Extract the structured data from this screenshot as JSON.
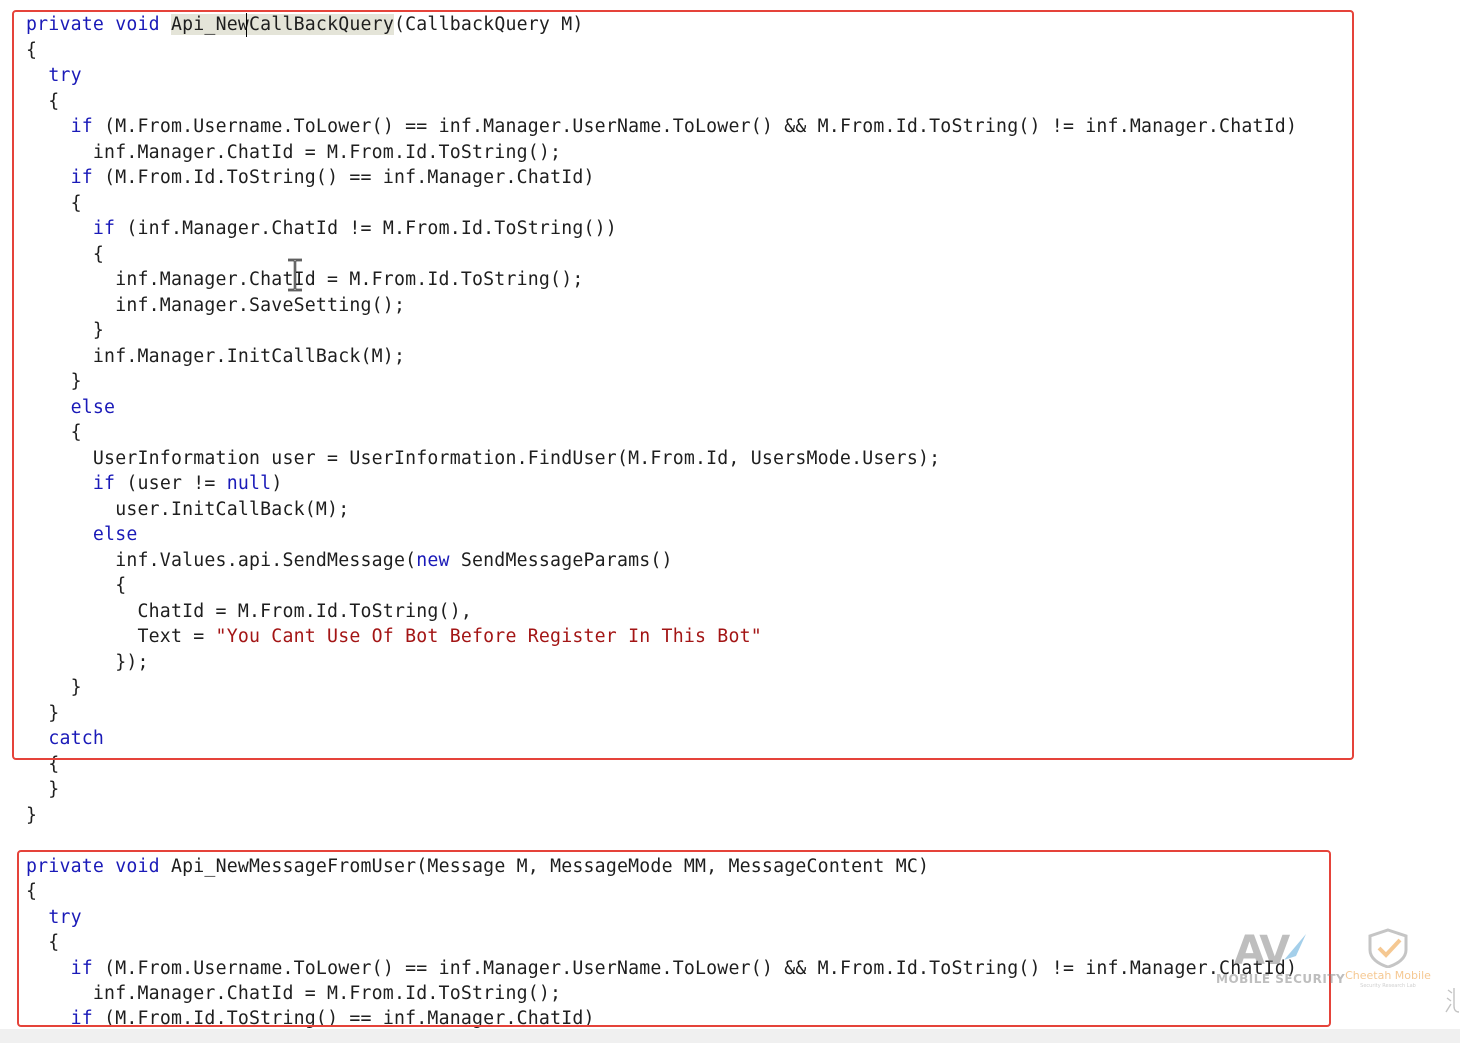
{
  "code": {
    "block1": [
      [
        [
          "kw",
          "private"
        ],
        [
          "t",
          " "
        ],
        [
          "kw",
          "void"
        ],
        [
          "t",
          " "
        ],
        [
          "hl",
          "Api_NewCallBackQuery"
        ],
        [
          "t",
          "(CallbackQuery M)"
        ]
      ],
      [
        [
          "t",
          "{"
        ]
      ],
      [
        [
          "t",
          "  "
        ],
        [
          "kw",
          "try"
        ]
      ],
      [
        [
          "t",
          "  {"
        ]
      ],
      [
        [
          "t",
          "    "
        ],
        [
          "kw",
          "if"
        ],
        [
          "t",
          " (M.From.Username.ToLower() == inf.Manager.UserName.ToLower() && M.From.Id.ToString() != inf.Manager.ChatId)"
        ]
      ],
      [
        [
          "t",
          "      inf.Manager.ChatId = M.From.Id.ToString();"
        ]
      ],
      [
        [
          "t",
          "    "
        ],
        [
          "kw",
          "if"
        ],
        [
          "t",
          " (M.From.Id.ToString() == inf.Manager.ChatId)"
        ]
      ],
      [
        [
          "t",
          "    {"
        ]
      ],
      [
        [
          "t",
          "      "
        ],
        [
          "kw",
          "if"
        ],
        [
          "t",
          " (inf.Manager.ChatId != M.From.Id.ToString())"
        ]
      ],
      [
        [
          "t",
          "      {"
        ]
      ],
      [
        [
          "t",
          "        inf.Manager.ChatId = M.From.Id.ToString();"
        ]
      ],
      [
        [
          "t",
          "        inf.Manager.SaveSetting();"
        ]
      ],
      [
        [
          "t",
          "      }"
        ]
      ],
      [
        [
          "t",
          "      inf.Manager.InitCallBack(M);"
        ]
      ],
      [
        [
          "t",
          "    }"
        ]
      ],
      [
        [
          "t",
          "    "
        ],
        [
          "kw",
          "else"
        ]
      ],
      [
        [
          "t",
          "    {"
        ]
      ],
      [
        [
          "t",
          "      UserInformation user = UserInformation.FindUser(M.From.Id, UsersMode.Users);"
        ]
      ],
      [
        [
          "t",
          "      "
        ],
        [
          "kw",
          "if"
        ],
        [
          "t",
          " (user != "
        ],
        [
          "kw",
          "null"
        ],
        [
          "t",
          ")"
        ]
      ],
      [
        [
          "t",
          "        user.InitCallBack(M);"
        ]
      ],
      [
        [
          "t",
          "      "
        ],
        [
          "kw",
          "else"
        ]
      ],
      [
        [
          "t",
          "        inf.Values.api.SendMessage("
        ],
        [
          "kw",
          "new"
        ],
        [
          "t",
          " SendMessageParams()"
        ]
      ],
      [
        [
          "t",
          "        {"
        ]
      ],
      [
        [
          "t",
          "          ChatId = M.From.Id.ToString(),"
        ]
      ],
      [
        [
          "t",
          "          Text = "
        ],
        [
          "str",
          "\"You Cant Use Of Bot Before Register In This Bot\""
        ]
      ],
      [
        [
          "t",
          "        });"
        ]
      ],
      [
        [
          "t",
          "    }"
        ]
      ],
      [
        [
          "t",
          "  }"
        ]
      ],
      [
        [
          "t",
          "  "
        ],
        [
          "kw",
          "catch"
        ]
      ],
      [
        [
          "t",
          "  {"
        ]
      ],
      [
        [
          "t",
          "  }"
        ]
      ],
      [
        [
          "t",
          "}"
        ]
      ]
    ],
    "block2": [
      [
        [
          "kw",
          "private"
        ],
        [
          "t",
          " "
        ],
        [
          "kw",
          "void"
        ],
        [
          "t",
          " Api_NewMessageFromUser(Message M, MessageMode MM, MessageContent MC)"
        ]
      ],
      [
        [
          "t",
          "{"
        ]
      ],
      [
        [
          "t",
          "  "
        ],
        [
          "kw",
          "try"
        ]
      ],
      [
        [
          "t",
          "  {"
        ]
      ],
      [
        [
          "t",
          "    "
        ],
        [
          "kw",
          "if"
        ],
        [
          "t",
          " (M.From.Username.ToLower() == inf.Manager.UserName.ToLower() && M.From.Id.ToString() != inf.Manager.ChatId)"
        ]
      ],
      [
        [
          "t",
          "      inf.Manager.ChatId = M.From.Id.ToString();"
        ]
      ],
      [
        [
          "t",
          "    "
        ],
        [
          "kw",
          "if"
        ],
        [
          "t",
          " (M.From.Id.ToString() == inf.Manager.ChatId)"
        ]
      ]
    ]
  },
  "watermarks": {
    "av_logo_text": "AV",
    "av_sub_text": "MOBILE SECURITY",
    "cm_text": "Cheetah Mobile",
    "cm_sub_text": "Security Research Lab"
  },
  "colors": {
    "keyword": "#1a1ab8",
    "string": "#a31515",
    "text": "#1e1e1e",
    "frame": "#e5433a",
    "highlight": "#e4e4d8"
  }
}
